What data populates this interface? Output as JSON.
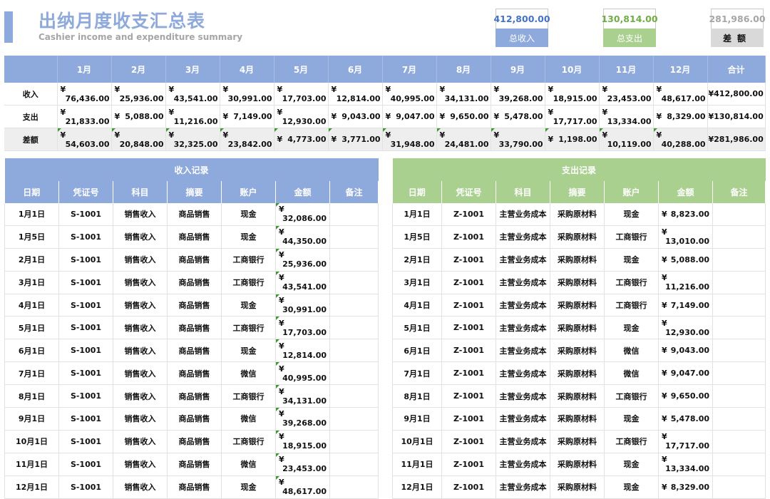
{
  "header": {
    "title": "出纳月度收支汇总表",
    "subtitle": "Cashier income and expenditure summary"
  },
  "kpis": {
    "income": {
      "value": "412,800.00",
      "label": "总收入"
    },
    "expense": {
      "value": "130,814.00",
      "label": "总支出"
    },
    "difference": {
      "value": "281,986.00",
      "label": "差额"
    }
  },
  "colors": {
    "income_accent": "#8ea9db",
    "expense_accent": "#a9d08e",
    "difference_accent": "#d9d9d9"
  },
  "summary": {
    "months": [
      "1月",
      "2月",
      "3月",
      "4月",
      "5月",
      "6月",
      "7月",
      "8月",
      "9月",
      "10月",
      "11月",
      "12月"
    ],
    "total_header": "合计",
    "currency": "¥",
    "rows": [
      {
        "label": "收入",
        "values": [
          "76,436.00",
          "25,936.00",
          "43,541.00",
          "30,991.00",
          "17,703.00",
          "12,814.00",
          "40,995.00",
          "34,131.00",
          "39,268.00",
          "18,915.00",
          "23,453.00",
          "48,617.00"
        ],
        "total": "¥412,800.00"
      },
      {
        "label": "支出",
        "values": [
          "21,833.00",
          "5,088.00",
          "11,216.00",
          "7,149.00",
          "12,930.00",
          "9,043.00",
          "9,047.00",
          "9,650.00",
          "5,478.00",
          "17,717.00",
          "13,334.00",
          "8,329.00"
        ],
        "total": "¥130,814.00"
      },
      {
        "label": "差额",
        "values": [
          "54,603.00",
          "20,848.00",
          "32,325.00",
          "23,842.00",
          "4,773.00",
          "3,771.00",
          "31,948.00",
          "24,481.00",
          "33,790.00",
          "1,198.00",
          "10,119.00",
          "40,288.00"
        ],
        "total": "¥281,986.00"
      }
    ]
  },
  "income_records": {
    "caption": "收入记录",
    "headers": [
      "日期",
      "凭证号",
      "科目",
      "摘要",
      "账户",
      "金额",
      "备注"
    ],
    "rows": [
      {
        "date": "1月1日",
        "voucher": "S-1001",
        "subject": "销售收入",
        "summary": "商品销售",
        "account": "现金",
        "currency": "¥",
        "amount": "32,086.00",
        "note": ""
      },
      {
        "date": "1月5日",
        "voucher": "S-1001",
        "subject": "销售收入",
        "summary": "商品销售",
        "account": "现金",
        "currency": "¥",
        "amount": "44,350.00",
        "note": ""
      },
      {
        "date": "2月1日",
        "voucher": "S-1001",
        "subject": "销售收入",
        "summary": "商品销售",
        "account": "工商银行",
        "currency": "¥",
        "amount": "25,936.00",
        "note": ""
      },
      {
        "date": "3月1日",
        "voucher": "S-1001",
        "subject": "销售收入",
        "summary": "商品销售",
        "account": "工商银行",
        "currency": "¥",
        "amount": "43,541.00",
        "note": ""
      },
      {
        "date": "4月1日",
        "voucher": "S-1001",
        "subject": "销售收入",
        "summary": "商品销售",
        "account": "现金",
        "currency": "¥",
        "amount": "30,991.00",
        "note": ""
      },
      {
        "date": "5月1日",
        "voucher": "S-1001",
        "subject": "销售收入",
        "summary": "商品销售",
        "account": "工商银行",
        "currency": "¥",
        "amount": "17,703.00",
        "note": ""
      },
      {
        "date": "6月1日",
        "voucher": "S-1001",
        "subject": "销售收入",
        "summary": "商品销售",
        "account": "现金",
        "currency": "¥",
        "amount": "12,814.00",
        "note": ""
      },
      {
        "date": "7月1日",
        "voucher": "S-1001",
        "subject": "销售收入",
        "summary": "商品销售",
        "account": "微信",
        "currency": "¥",
        "amount": "40,995.00",
        "note": ""
      },
      {
        "date": "8月1日",
        "voucher": "S-1001",
        "subject": "销售收入",
        "summary": "商品销售",
        "account": "工商银行",
        "currency": "¥",
        "amount": "34,131.00",
        "note": ""
      },
      {
        "date": "9月1日",
        "voucher": "S-1001",
        "subject": "销售收入",
        "summary": "商品销售",
        "account": "微信",
        "currency": "¥",
        "amount": "39,268.00",
        "note": ""
      },
      {
        "date": "10月1日",
        "voucher": "S-1001",
        "subject": "销售收入",
        "summary": "商品销售",
        "account": "工商银行",
        "currency": "¥",
        "amount": "18,915.00",
        "note": ""
      },
      {
        "date": "11月1日",
        "voucher": "S-1001",
        "subject": "销售收入",
        "summary": "商品销售",
        "account": "微信",
        "currency": "¥",
        "amount": "23,453.00",
        "note": ""
      },
      {
        "date": "12月1日",
        "voucher": "S-1001",
        "subject": "销售收入",
        "summary": "商品销售",
        "account": "现金",
        "currency": "¥",
        "amount": "48,617.00",
        "note": ""
      }
    ]
  },
  "expense_records": {
    "caption": "支出记录",
    "headers": [
      "日期",
      "凭证号",
      "科目",
      "摘要",
      "账户",
      "金额",
      "备注"
    ],
    "rows": [
      {
        "date": "1月1日",
        "voucher": "Z-1001",
        "subject": "主营业务成本",
        "summary": "采购原材料",
        "account": "现金",
        "currency": "¥",
        "amount": "8,823.00",
        "note": ""
      },
      {
        "date": "1月5日",
        "voucher": "Z-1001",
        "subject": "主营业务成本",
        "summary": "采购原材料",
        "account": "工商银行",
        "currency": "¥",
        "amount": "13,010.00",
        "note": ""
      },
      {
        "date": "2月1日",
        "voucher": "Z-1001",
        "subject": "主营业务成本",
        "summary": "采购原材料",
        "account": "现金",
        "currency": "¥",
        "amount": "5,088.00",
        "note": ""
      },
      {
        "date": "3月1日",
        "voucher": "Z-1001",
        "subject": "主营业务成本",
        "summary": "采购原材料",
        "account": "工商银行",
        "currency": "¥",
        "amount": "11,216.00",
        "note": ""
      },
      {
        "date": "4月1日",
        "voucher": "Z-1001",
        "subject": "主营业务成本",
        "summary": "采购原材料",
        "account": "工商银行",
        "currency": "¥",
        "amount": "7,149.00",
        "note": ""
      },
      {
        "date": "5月1日",
        "voucher": "Z-1001",
        "subject": "主营业务成本",
        "summary": "采购原材料",
        "account": "现金",
        "currency": "¥",
        "amount": "12,930.00",
        "note": ""
      },
      {
        "date": "6月1日",
        "voucher": "Z-1001",
        "subject": "主营业务成本",
        "summary": "采购原材料",
        "account": "微信",
        "currency": "¥",
        "amount": "9,043.00",
        "note": ""
      },
      {
        "date": "7月1日",
        "voucher": "Z-1001",
        "subject": "主营业务成本",
        "summary": "采购原材料",
        "account": "微信",
        "currency": "¥",
        "amount": "9,047.00",
        "note": ""
      },
      {
        "date": "8月1日",
        "voucher": "Z-1001",
        "subject": "主营业务成本",
        "summary": "采购原材料",
        "account": "工商银行",
        "currency": "¥",
        "amount": "9,650.00",
        "note": ""
      },
      {
        "date": "9月1日",
        "voucher": "Z-1001",
        "subject": "主营业务成本",
        "summary": "采购原材料",
        "account": "现金",
        "currency": "¥",
        "amount": "5,478.00",
        "note": ""
      },
      {
        "date": "10月1日",
        "voucher": "Z-1001",
        "subject": "主营业务成本",
        "summary": "采购原材料",
        "account": "工商银行",
        "currency": "¥",
        "amount": "17,717.00",
        "note": ""
      },
      {
        "date": "11月1日",
        "voucher": "Z-1001",
        "subject": "主营业务成本",
        "summary": "采购原材料",
        "account": "现金",
        "currency": "¥",
        "amount": "13,334.00",
        "note": ""
      },
      {
        "date": "12月1日",
        "voucher": "Z-1001",
        "subject": "主营业务成本",
        "summary": "采购原材料",
        "account": "现金",
        "currency": "¥",
        "amount": "8,329.00",
        "note": ""
      }
    ]
  }
}
